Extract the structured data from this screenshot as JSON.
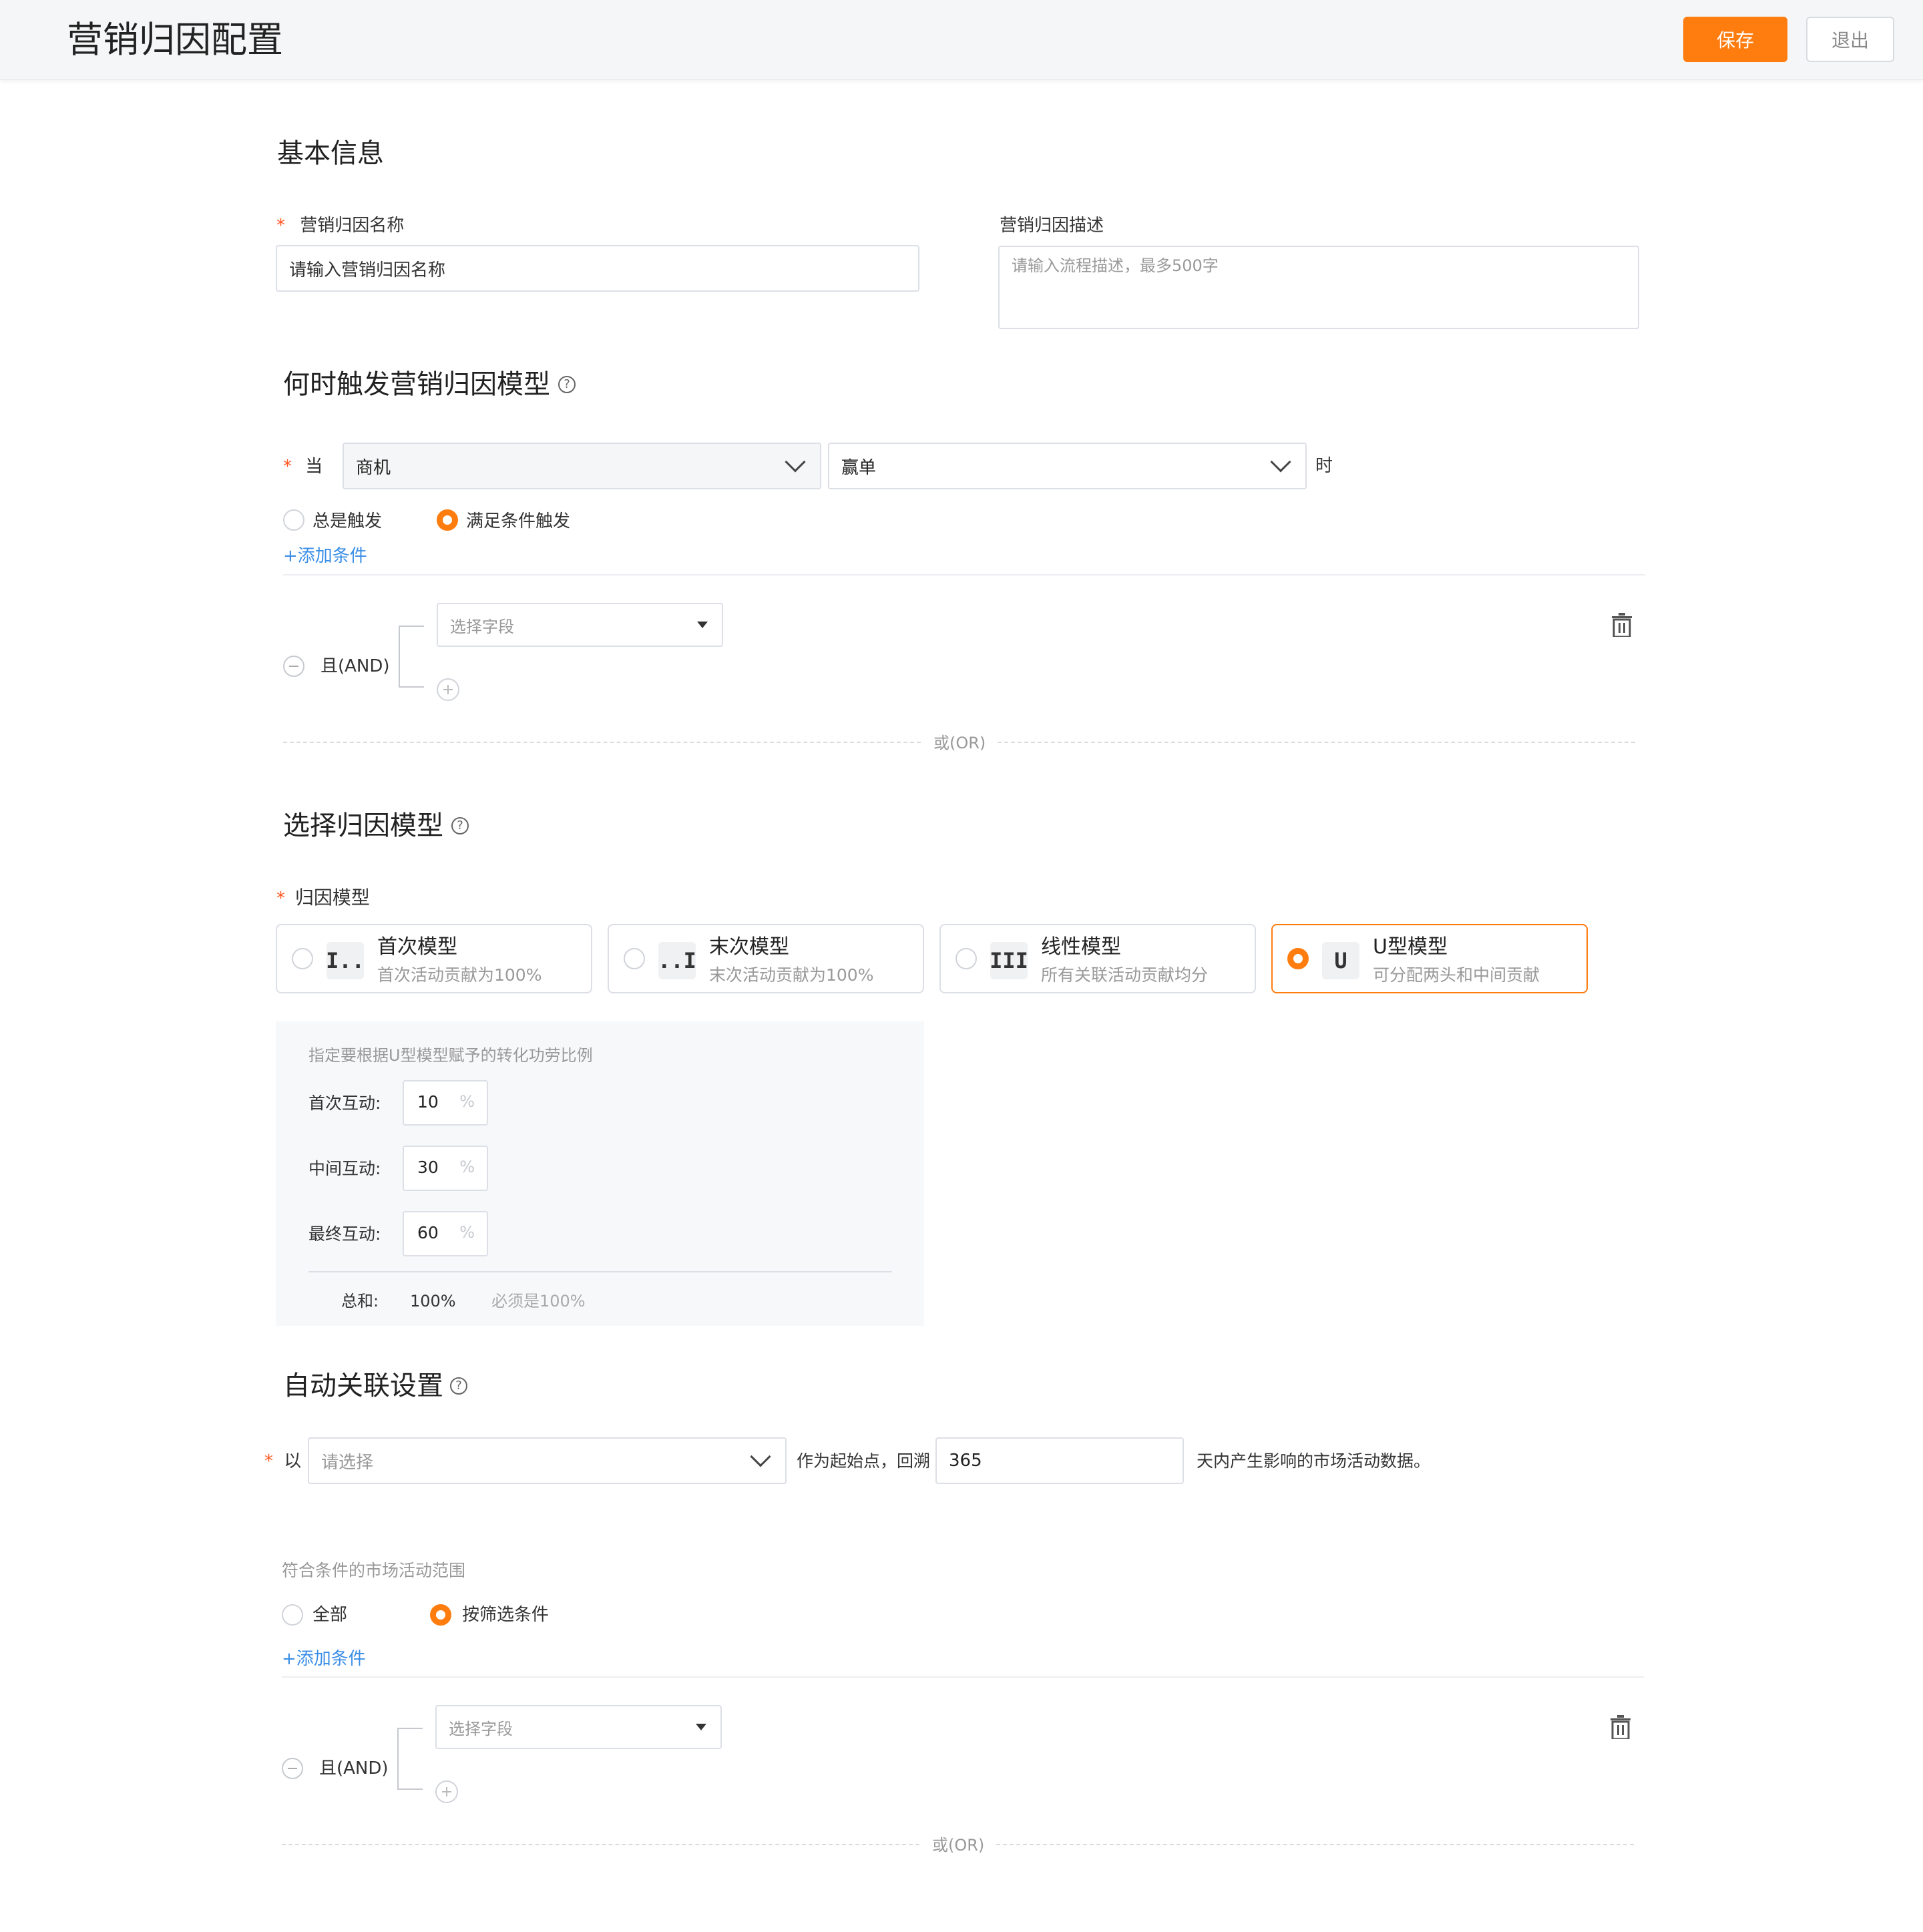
{
  "header": {
    "title": "营销归因配置",
    "save_label": "保存",
    "exit_label": "退出"
  },
  "basic": {
    "section_title": "基本信息",
    "name_label": "营销归因名称",
    "name_placeholder": "请输入营销归因名称",
    "desc_label": "营销归因描述",
    "desc_placeholder": "请输入流程描述，最多500字"
  },
  "trigger": {
    "section_title": "何时触发营销归因模型",
    "when_label": "当",
    "object_value": "商机",
    "stage_value": "赢单",
    "suffix": "时",
    "radio_always": "总是触发",
    "radio_condition": "满足条件触发",
    "selected": "condition",
    "add_condition": "+添加条件",
    "and_label": "且(AND)",
    "field_placeholder": "选择字段",
    "or_label": "或(OR)"
  },
  "model": {
    "section_title": "选择归因模型",
    "label": "归因模型",
    "cards": [
      {
        "icon": "first-touch-icon",
        "glyph": "I..",
        "title": "首次模型",
        "desc": "首次活动贡献为100%"
      },
      {
        "icon": "last-touch-icon",
        "glyph": "..I",
        "title": "末次模型",
        "desc": "末次活动贡献为100%"
      },
      {
        "icon": "linear-icon",
        "glyph": "III",
        "title": "线性模型",
        "desc": "所有关联活动贡献均分"
      },
      {
        "icon": "u-shape-icon",
        "glyph": "U",
        "title": "U型模型",
        "desc": "可分配两头和中间贡献"
      }
    ],
    "selected_index": 3,
    "panel_hint": "指定要根据U型模型赋予的转化功劳比例",
    "first_label": "首次互动:",
    "first_value": "10",
    "middle_label": "中间互动:",
    "middle_value": "30",
    "last_label": "最终互动:",
    "last_value": "60",
    "unit": "%",
    "sum_label": "总和:",
    "sum_value": "100%",
    "sum_hint": "必须是100%"
  },
  "auto": {
    "section_title": "自动关联设置",
    "prefix": "以",
    "select_placeholder": "请选择",
    "middle_text": "作为起始点，回溯",
    "days_value": "365",
    "suffix": "天内产生影响的市场活动数据。",
    "scope_label": "符合条件的市场活动范围",
    "radio_all": "全部",
    "radio_filter": "按筛选条件",
    "selected": "filter",
    "add_condition": "+添加条件",
    "and_label": "且(AND)",
    "field_placeholder": "选择字段",
    "or_label": "或(OR)"
  },
  "colors": {
    "accent": "#ff7c0f",
    "link": "#3a8ee6",
    "required": "#ff5722"
  }
}
